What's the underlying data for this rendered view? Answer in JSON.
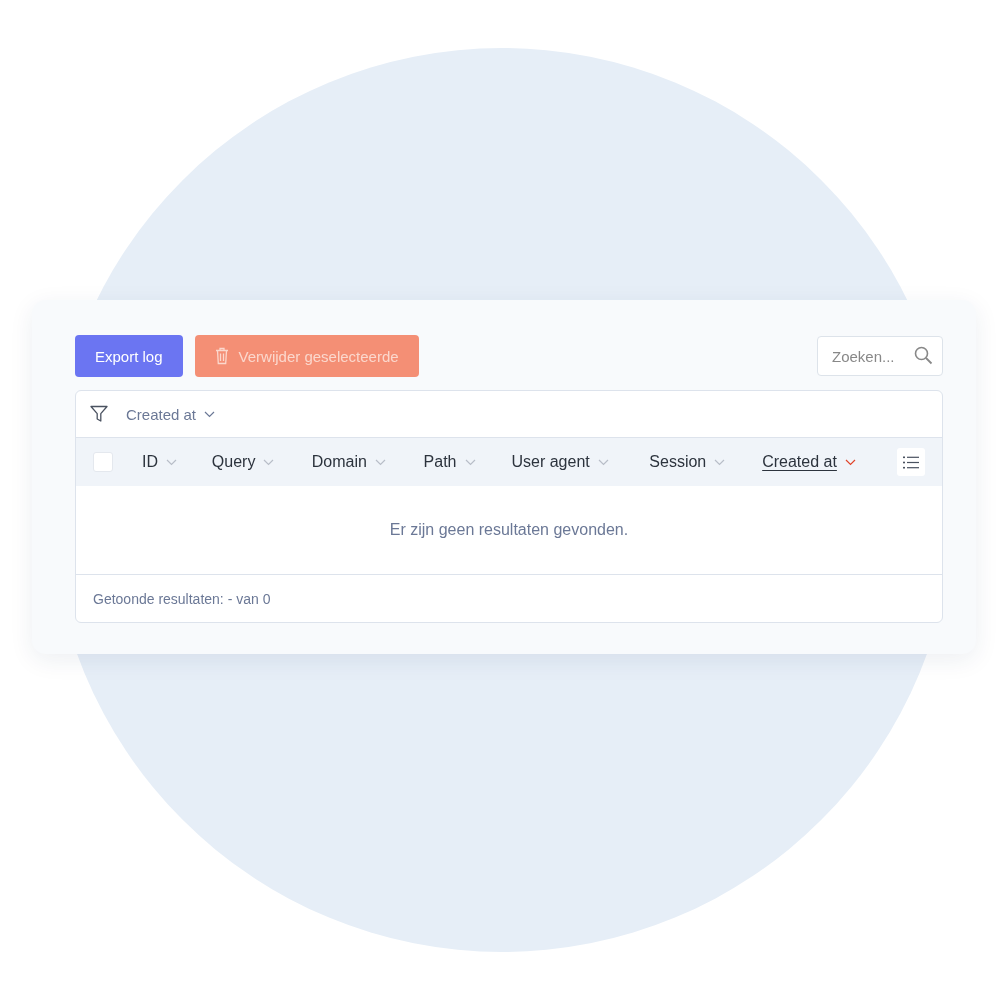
{
  "toolbar": {
    "export_button": "Export log",
    "delete_button": {
      "label": "Verwijder geselecteerde",
      "disabled": true
    },
    "search": {
      "placeholder": "Zoeken..."
    }
  },
  "filter": {
    "label": "Created at"
  },
  "table": {
    "select_all": {
      "checked": false
    },
    "columns": [
      {
        "label": "ID",
        "sorted": false
      },
      {
        "label": "Query",
        "sorted": false
      },
      {
        "label": "Domain",
        "sorted": false
      },
      {
        "label": "Path",
        "sorted": false
      },
      {
        "label": "User agent",
        "sorted": false
      },
      {
        "label": "Session",
        "sorted": false
      },
      {
        "label": "Created at",
        "sorted": true
      }
    ],
    "empty_message": "Er zijn geen resultaten gevonden.",
    "footer": "Getoonde resultaten: - van 0"
  }
}
